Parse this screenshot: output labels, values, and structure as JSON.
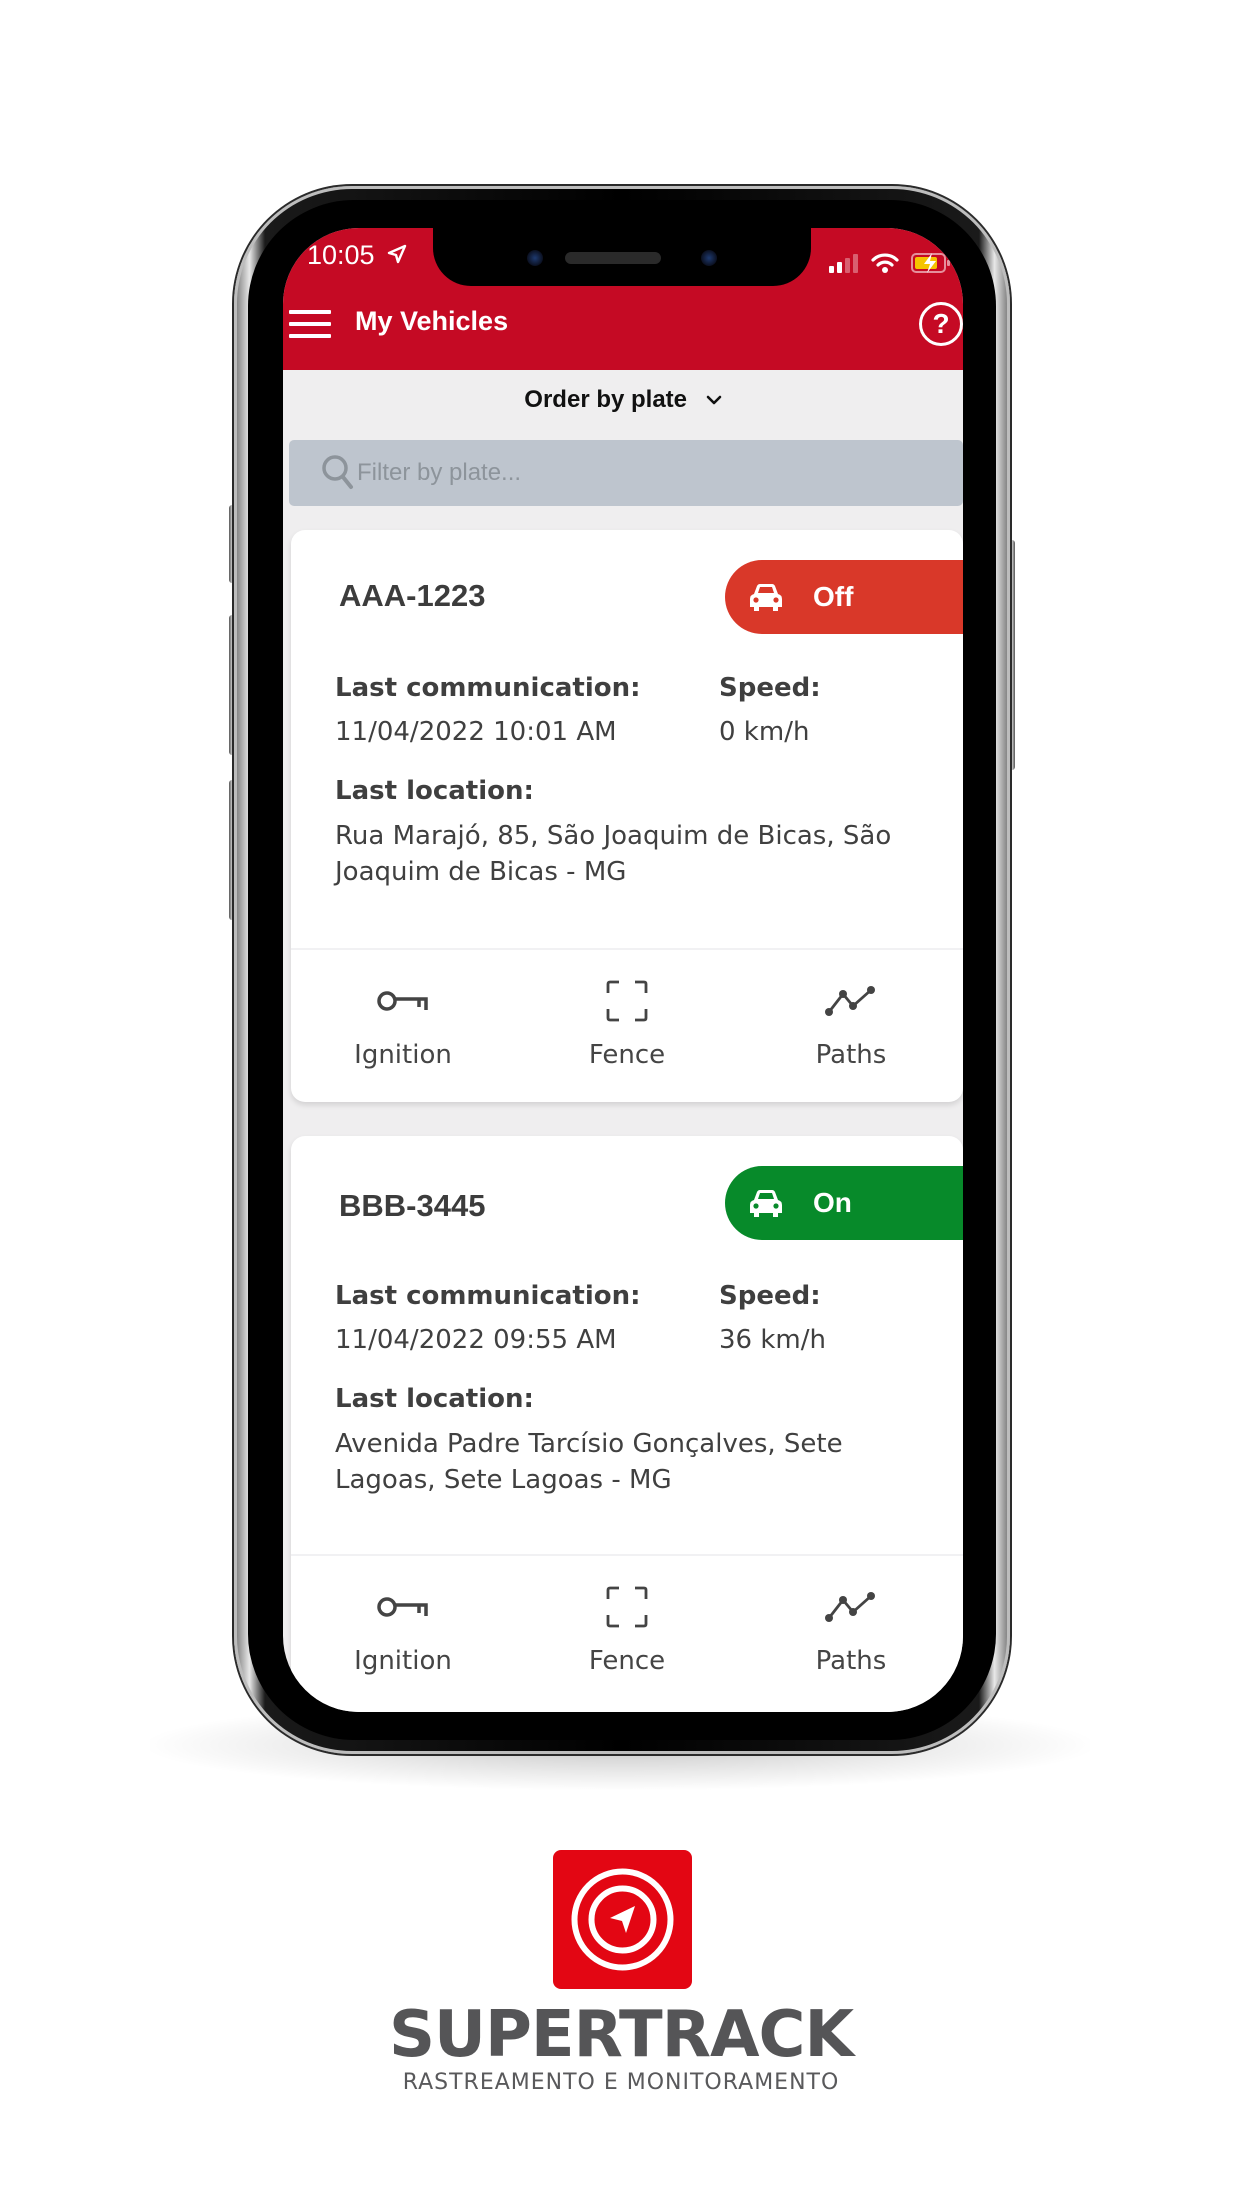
{
  "status_bar": {
    "time": "10:05"
  },
  "header": {
    "title": "My Vehicles",
    "help_label": "?"
  },
  "toolbar": {
    "order_label": "Order by plate",
    "search_placeholder": "Filter by plate...",
    "search_value": ""
  },
  "vehicles": [
    {
      "plate": "AAA-1223",
      "status": "Off",
      "status_color": "#d93829",
      "last_comm_label": "Last communication:",
      "last_comm": "11/04/2022 10:01 AM",
      "speed_label": "Speed:",
      "speed": "0 km/h",
      "location_label": "Last location:",
      "location": "Rua Marajó, 85, São Joaquim de Bicas, São Joaquim de Bicas - MG",
      "actions": [
        "Ignition",
        "Fence",
        "Paths"
      ]
    },
    {
      "plate": "BBB-3445",
      "status": "On",
      "status_color": "#078a2a",
      "last_comm_label": "Last communication:",
      "last_comm": "11/04/2022 09:55 AM",
      "speed_label": "Speed:",
      "speed": "36 km/h",
      "location_label": "Last location:",
      "location": "Avenida Padre Tarcísio Gonçalves, Sete Lagoas, Sete Lagoas - MG",
      "actions": [
        "Ignition",
        "Fence",
        "Paths"
      ]
    }
  ],
  "branding": {
    "name": "SUPERTRACK",
    "tagline": "RASTREAMENTO E MONITORAMENTO",
    "color": "#e30613"
  },
  "colors": {
    "header": "#c50a24",
    "background": "#efeeef",
    "search": "#bec5ce"
  }
}
